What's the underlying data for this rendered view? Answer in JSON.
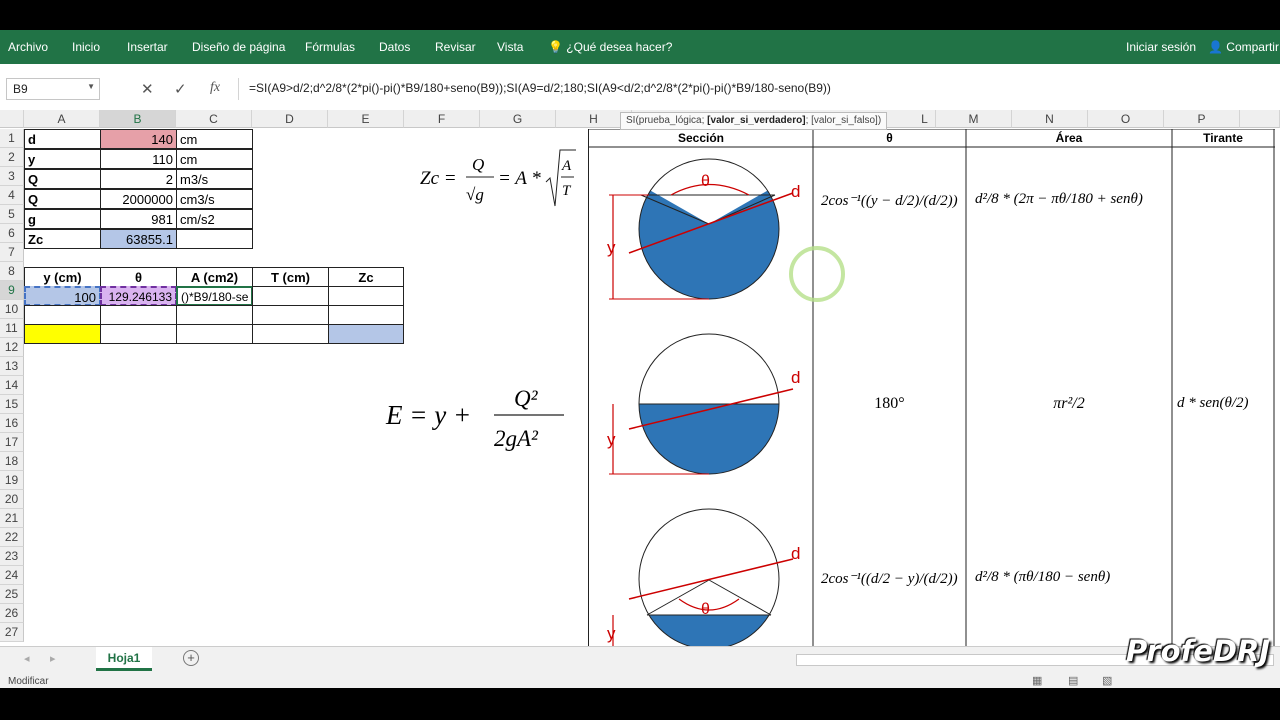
{
  "ribbon": {
    "tabs": [
      "Archivo",
      "Inicio",
      "Insertar",
      "Diseño de página",
      "Fórmulas",
      "Datos",
      "Revisar",
      "Vista"
    ],
    "tell_me": "¿Qué desea hacer?",
    "signin": "Iniciar sesión",
    "share": "Compartir"
  },
  "formula_bar": {
    "namebox": "B9",
    "cancel": "✕",
    "enter": "✓",
    "fx": "fx",
    "formula": "=SI(A9>d/2;d^2/8*(2*pi()-pi()*B9/180+seno(B9));SI(A9=d/2;180;SI(A9<d/2;d^2/8*(2*pi()-pi()*B9/180-seno(B9))"
  },
  "tooltip": {
    "fn": "SI(prueba_lógica; ",
    "bold_arg": "[valor_si_verdadero]",
    "rest": "; [valor_si_falso])"
  },
  "columns": [
    "A",
    "B",
    "C",
    "D",
    "E",
    "F",
    "G",
    "H",
    "L",
    "M",
    "N",
    "O",
    "P"
  ],
  "rows": [
    "1",
    "2",
    "3",
    "4",
    "5",
    "6",
    "7",
    "8",
    "9",
    "10",
    "11",
    "12",
    "13",
    "14",
    "15",
    "16",
    "17",
    "18",
    "19",
    "20",
    "21",
    "22",
    "23",
    "24",
    "25",
    "26",
    "27"
  ],
  "params": [
    {
      "name": "d",
      "value": "140",
      "unit": "cm"
    },
    {
      "name": "y",
      "value": "110",
      "unit": "cm"
    },
    {
      "name": "Q",
      "value": "2",
      "unit": "m3/s"
    },
    {
      "name": "Q",
      "value": "2000000",
      "unit": "cm3/s"
    },
    {
      "name": "g",
      "value": "981",
      "unit": "cm/s2"
    },
    {
      "name": "Zc",
      "value": "63855.1",
      "unit": ""
    }
  ],
  "calc_table": {
    "headers": [
      "y (cm)",
      "θ",
      "A (cm2)",
      "T (cm)",
      "Zc"
    ],
    "row9": [
      "100",
      "129.246133",
      "()*B9/180-se",
      "",
      ""
    ]
  },
  "formulas": {
    "zc": "Zc = Q/√g = A * √(A/T)",
    "energy": "E = y + Q²/(2gA²)"
  },
  "ref_table": {
    "headers": [
      "Sección",
      "θ",
      "Área",
      "Tirante"
    ],
    "row1": {
      "theta": "2cos⁻¹((y − d/2)/(d/2))",
      "area": "d²/8 * (2π − πθ/180 + senθ)",
      "tirante": ""
    },
    "row2": {
      "theta": "180°",
      "area": "πr²/2",
      "tirante": "d * sen(θ/2)"
    },
    "row3": {
      "theta": "2cos⁻¹((d/2 − y)/(d/2))",
      "area": "d²/8 * (πθ/180 − senθ)",
      "tirante": ""
    },
    "labels": {
      "d": "d",
      "y": "y",
      "theta": "θ"
    }
  },
  "sheet": {
    "name": "Hoja1",
    "add": "+"
  },
  "status": "Modificar",
  "watermark": "ProfeDRJ",
  "colors": {
    "accent": "#217346",
    "red": "#e6a0a8",
    "blue": "#b4c6e7",
    "purple": "#d9b3f0",
    "yellow": "#ffff00",
    "water": "#2e75b6"
  }
}
